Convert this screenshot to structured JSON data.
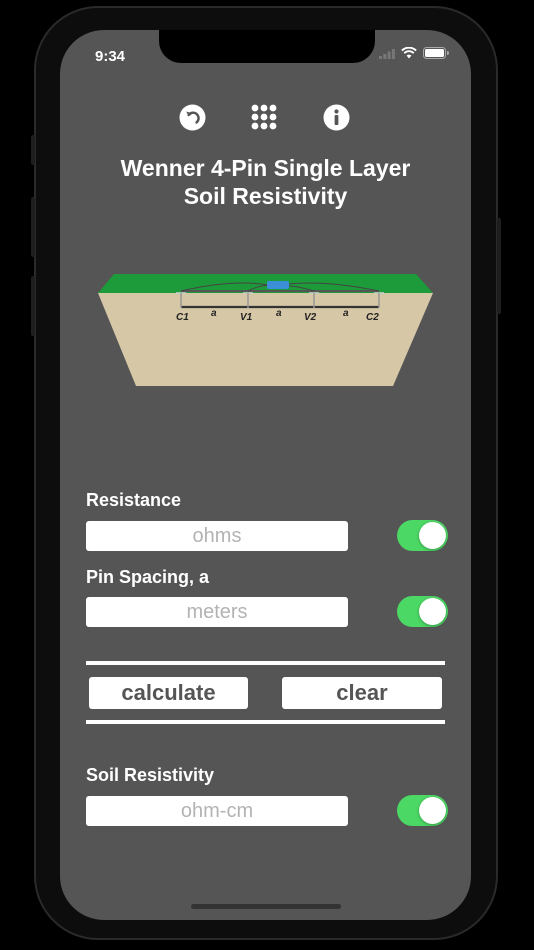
{
  "status_bar": {
    "time": "9:34"
  },
  "toolbar": {
    "icons": [
      "undo-icon",
      "grid-icon",
      "info-icon"
    ]
  },
  "title": {
    "line1": "Wenner 4-Pin Single Layer",
    "line2": "Soil Resistivity"
  },
  "diagram": {
    "labels": {
      "c1": "C1",
      "v1": "V1",
      "v2": "V2",
      "c2": "C2",
      "spacing": "a"
    },
    "colors": {
      "grass": "#1d9a3a",
      "soil": "#d6c7a6",
      "meter": "#3a8fd6"
    }
  },
  "inputs": {
    "resistance": {
      "label": "Resistance",
      "placeholder": "ohms"
    },
    "pin_spacing": {
      "label": "Pin Spacing, a",
      "placeholder": "meters"
    }
  },
  "buttons": {
    "calculate": "calculate",
    "clear": "clear"
  },
  "output": {
    "label": "Soil Resistivity",
    "placeholder": "ohm-cm"
  },
  "colors": {
    "background": "#555555",
    "toggle_on": "#4cd864"
  }
}
